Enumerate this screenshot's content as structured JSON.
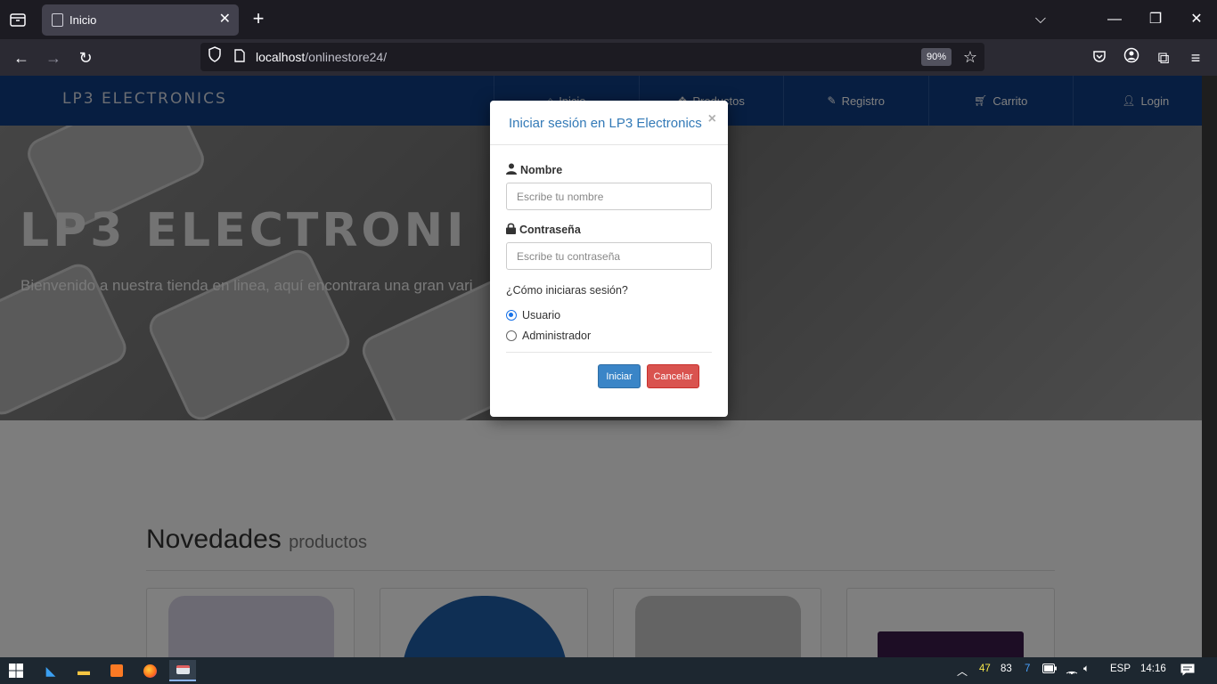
{
  "browser": {
    "tab_title": "Inicio",
    "url_host": "localhost",
    "url_path": "/onlinestore24/",
    "zoom": "90%"
  },
  "site": {
    "brand": "LP3 ELECTRONICS",
    "nav": [
      {
        "label": "Inicio",
        "icon": "home-icon"
      },
      {
        "label": "Productos",
        "icon": "cubes-icon"
      },
      {
        "label": "Registro",
        "icon": "edit-icon"
      },
      {
        "label": "Carrito",
        "icon": "cart-icon"
      },
      {
        "label": "Login",
        "icon": "user-icon"
      }
    ],
    "hero_title": "LP3 ELECTRONI",
    "hero_subtitle": "Bienvenido a nuestra tienda en linea, aquí encontrara una gran vari",
    "section_title": "Novedades",
    "section_subtitle": "productos"
  },
  "modal": {
    "title": "Iniciar sesión en LP3 Electronics",
    "close": "×",
    "name_label": "Nombre",
    "name_placeholder": "Escribe tu nombre",
    "password_label": "Contraseña",
    "password_placeholder": "Escribe tu contraseña",
    "question": "¿Cómo iniciaras sesión?",
    "options": [
      {
        "label": "Usuario",
        "checked": true
      },
      {
        "label": "Administrador",
        "checked": false
      }
    ],
    "submit": "Iniciar",
    "cancel": "Cancelar"
  },
  "taskbar": {
    "tray_numbers": [
      "47",
      "83",
      "7"
    ],
    "language": "ESP",
    "time": "14:16"
  },
  "colors": {
    "header": "#0e3c82",
    "modal_title": "#337ab7",
    "primary": "#3a85c7",
    "danger": "#d9534f"
  }
}
